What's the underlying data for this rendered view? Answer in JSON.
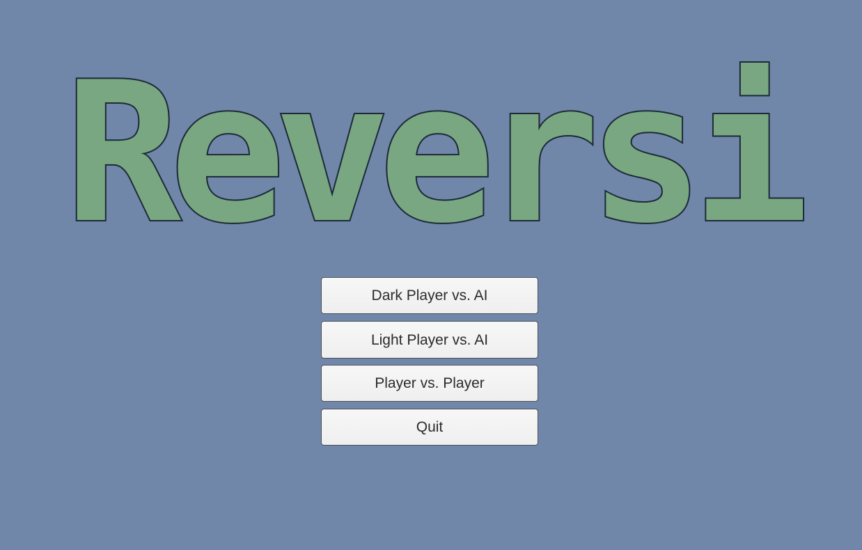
{
  "title": "Reversi",
  "menu": {
    "buttons": [
      {
        "label": "Dark Player vs. AI"
      },
      {
        "label": "Light Player vs. AI"
      },
      {
        "label": "Player vs. Player"
      },
      {
        "label": "Quit"
      }
    ]
  },
  "colors": {
    "background": "#7187aa",
    "title_fill": "#79a782",
    "title_outline": "#1f2d3a",
    "button_bg": "#f4f4f4",
    "button_text": "#2b2b2b"
  }
}
